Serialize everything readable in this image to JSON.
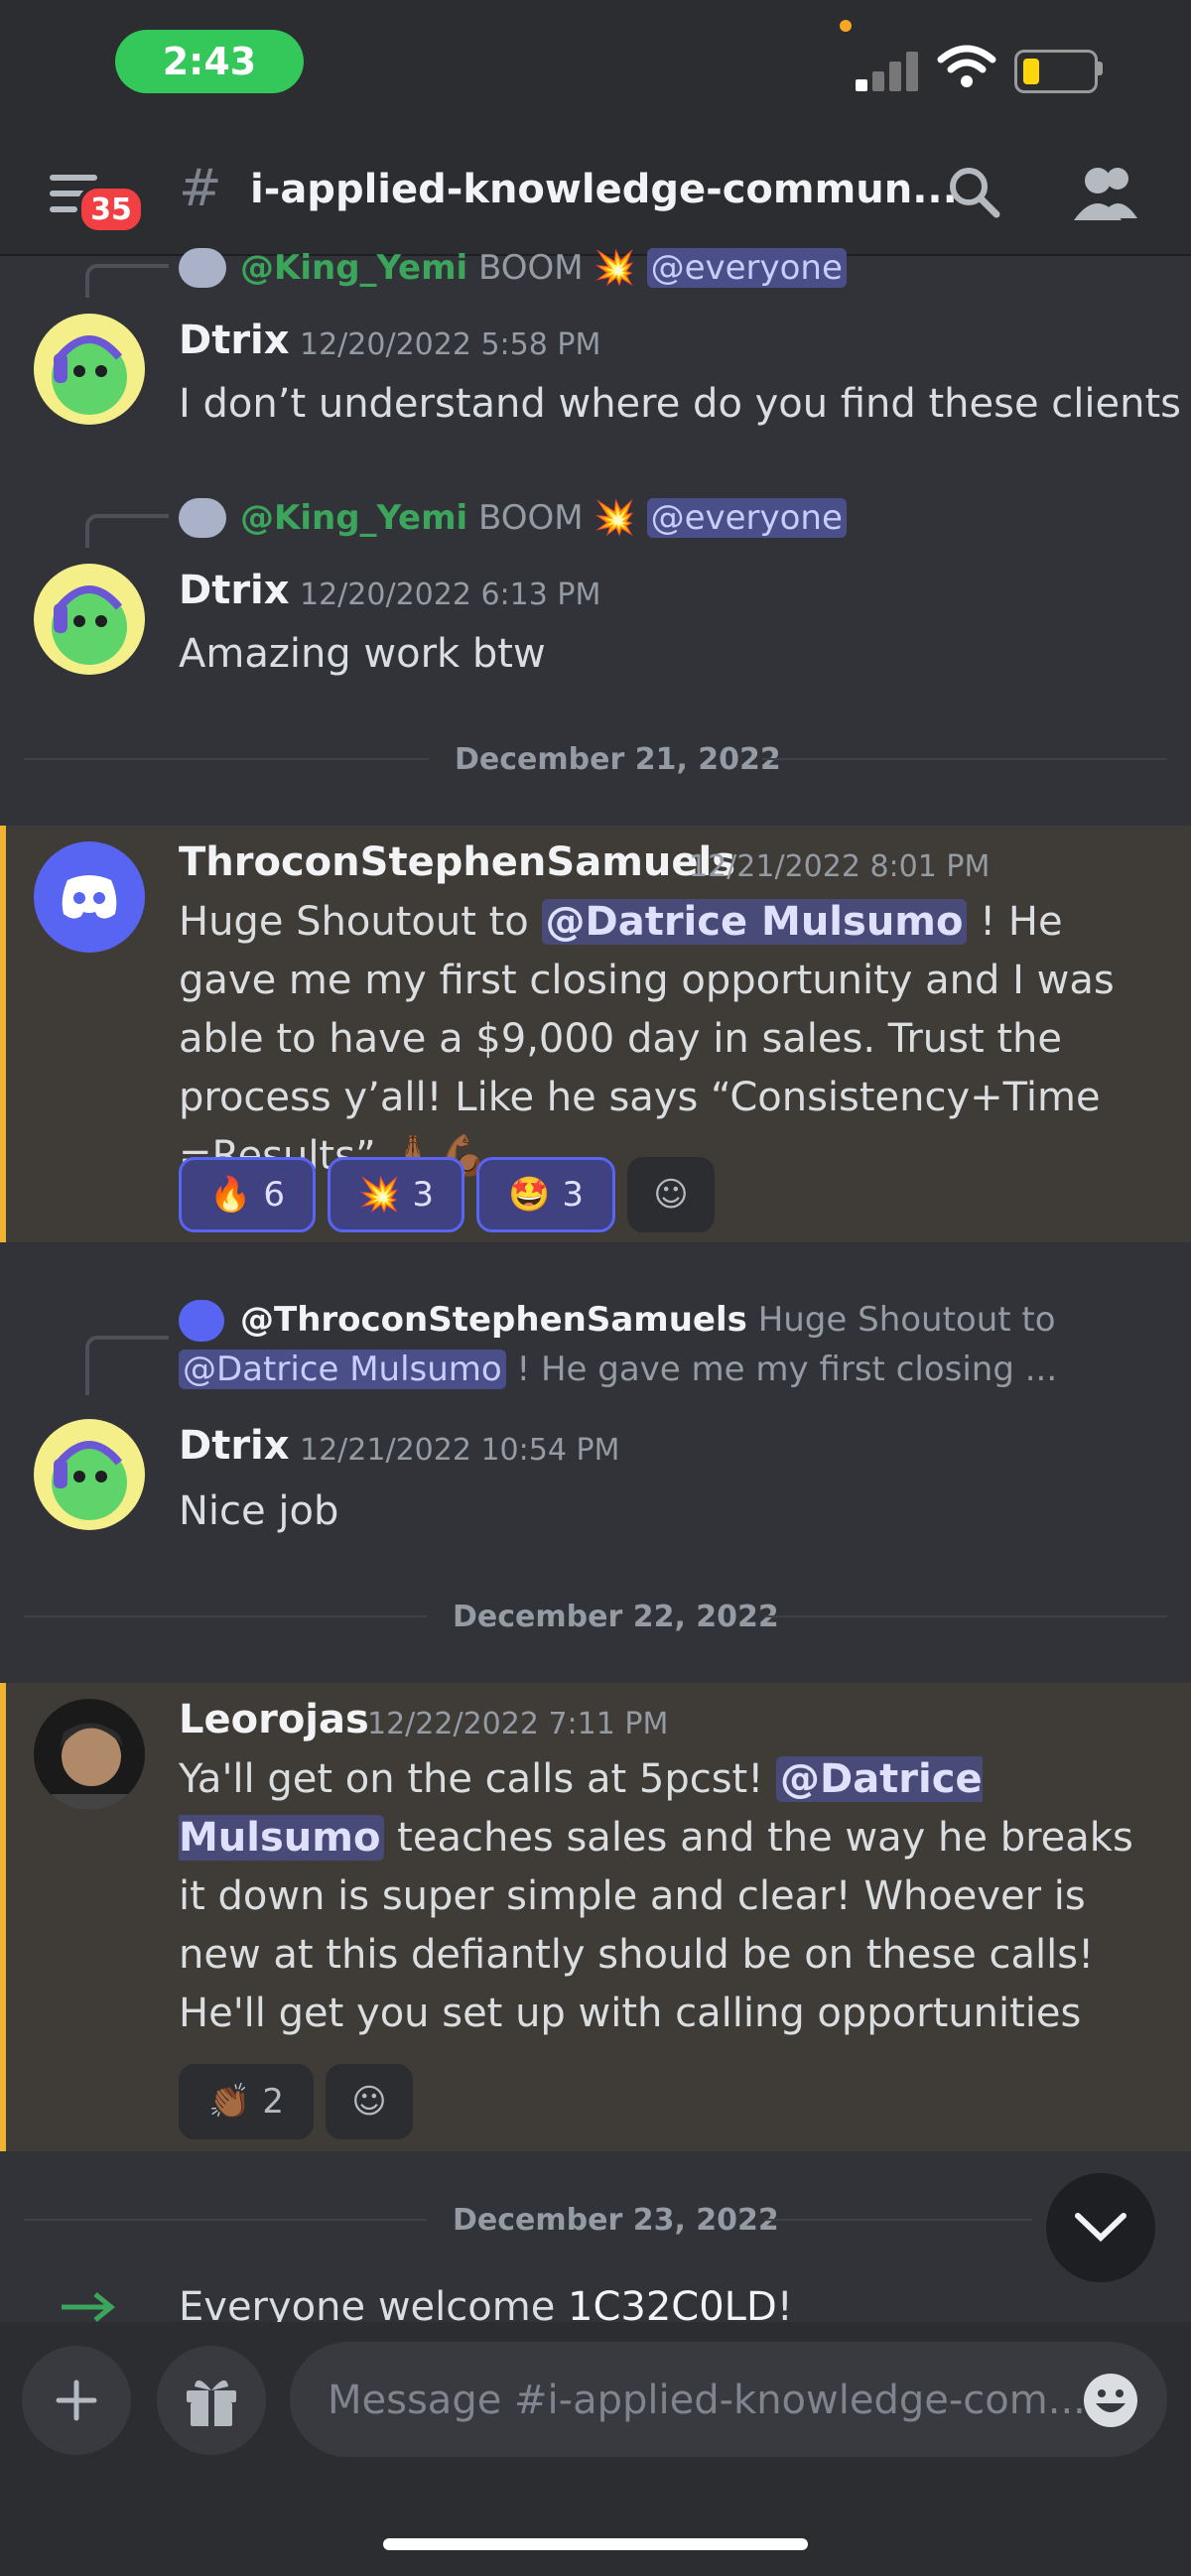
{
  "status_bar": {
    "time": "2:43"
  },
  "header": {
    "badge_count": "35",
    "hash": "#",
    "channel_name": "i-applied-knowledge-commun..."
  },
  "messages": [
    {
      "reply": {
        "name": "@King_Yemi",
        "text": "BOOM",
        "mention": "@everyone"
      },
      "author": "Dtrix",
      "timestamp": "12/20/2022 5:58 PM",
      "text": "I don’t understand where do you find these clients"
    },
    {
      "reply": {
        "name": "@King_Yemi",
        "text": "BOOM",
        "mention": "@everyone"
      },
      "author": "Dtrix",
      "timestamp": "12/20/2022 6:13 PM",
      "text": "Amazing work btw"
    },
    {
      "author": "ThroconStephenSamuels",
      "timestamp": "12/21/2022 8:01 PM",
      "text_before": "Huge Shoutout to ",
      "mention": "@Datrice Mulsumo",
      "text_after": " ! He gave me my first closing opportunity and I was able to have a $9,000 day in sales. Trust the process y’all! Like he says “Consistency+Time =Results”",
      "reactions": [
        {
          "emoji": "🔥",
          "count": "6"
        },
        {
          "emoji": "💥",
          "count": "3"
        },
        {
          "emoji": "🤩",
          "count": "3"
        }
      ]
    },
    {
      "reply": {
        "name": "@ThroconStephenSamuels",
        "text": "Huge Shoutout to",
        "mention": "@Datrice Mulsumo",
        "text2": "! He gave me my first closing ..."
      },
      "author": "Dtrix",
      "timestamp": "12/21/2022 10:54 PM",
      "text": "Nice job"
    },
    {
      "author": "Leorojas",
      "timestamp": "12/22/2022 7:11 PM",
      "text_before": "Ya'll get on the calls at 5pcst! ",
      "mention": "@Datrice Mulsumo",
      "text_after": " teaches sales and the way he breaks it down is super simple and clear! Whoever is new at this defiantly should be on these calls! He'll get you set up with calling opportunities",
      "reactions": [
        {
          "emoji": "👏🏾",
          "count": "2"
        }
      ]
    }
  ],
  "dividers": [
    "December 21, 2022",
    "December 22, 2022",
    "December 23, 2022"
  ],
  "system_message": {
    "text": "Everyone welcome ",
    "name": "1C32C0LD",
    "suffix": "!"
  },
  "composer": {
    "placeholder": "Message #i-applied-knowledge-com..."
  },
  "colors": {
    "background": "#313338",
    "accent": "#5865f2",
    "highlight_bar": "#f0b232",
    "status_green": "#34c759"
  }
}
